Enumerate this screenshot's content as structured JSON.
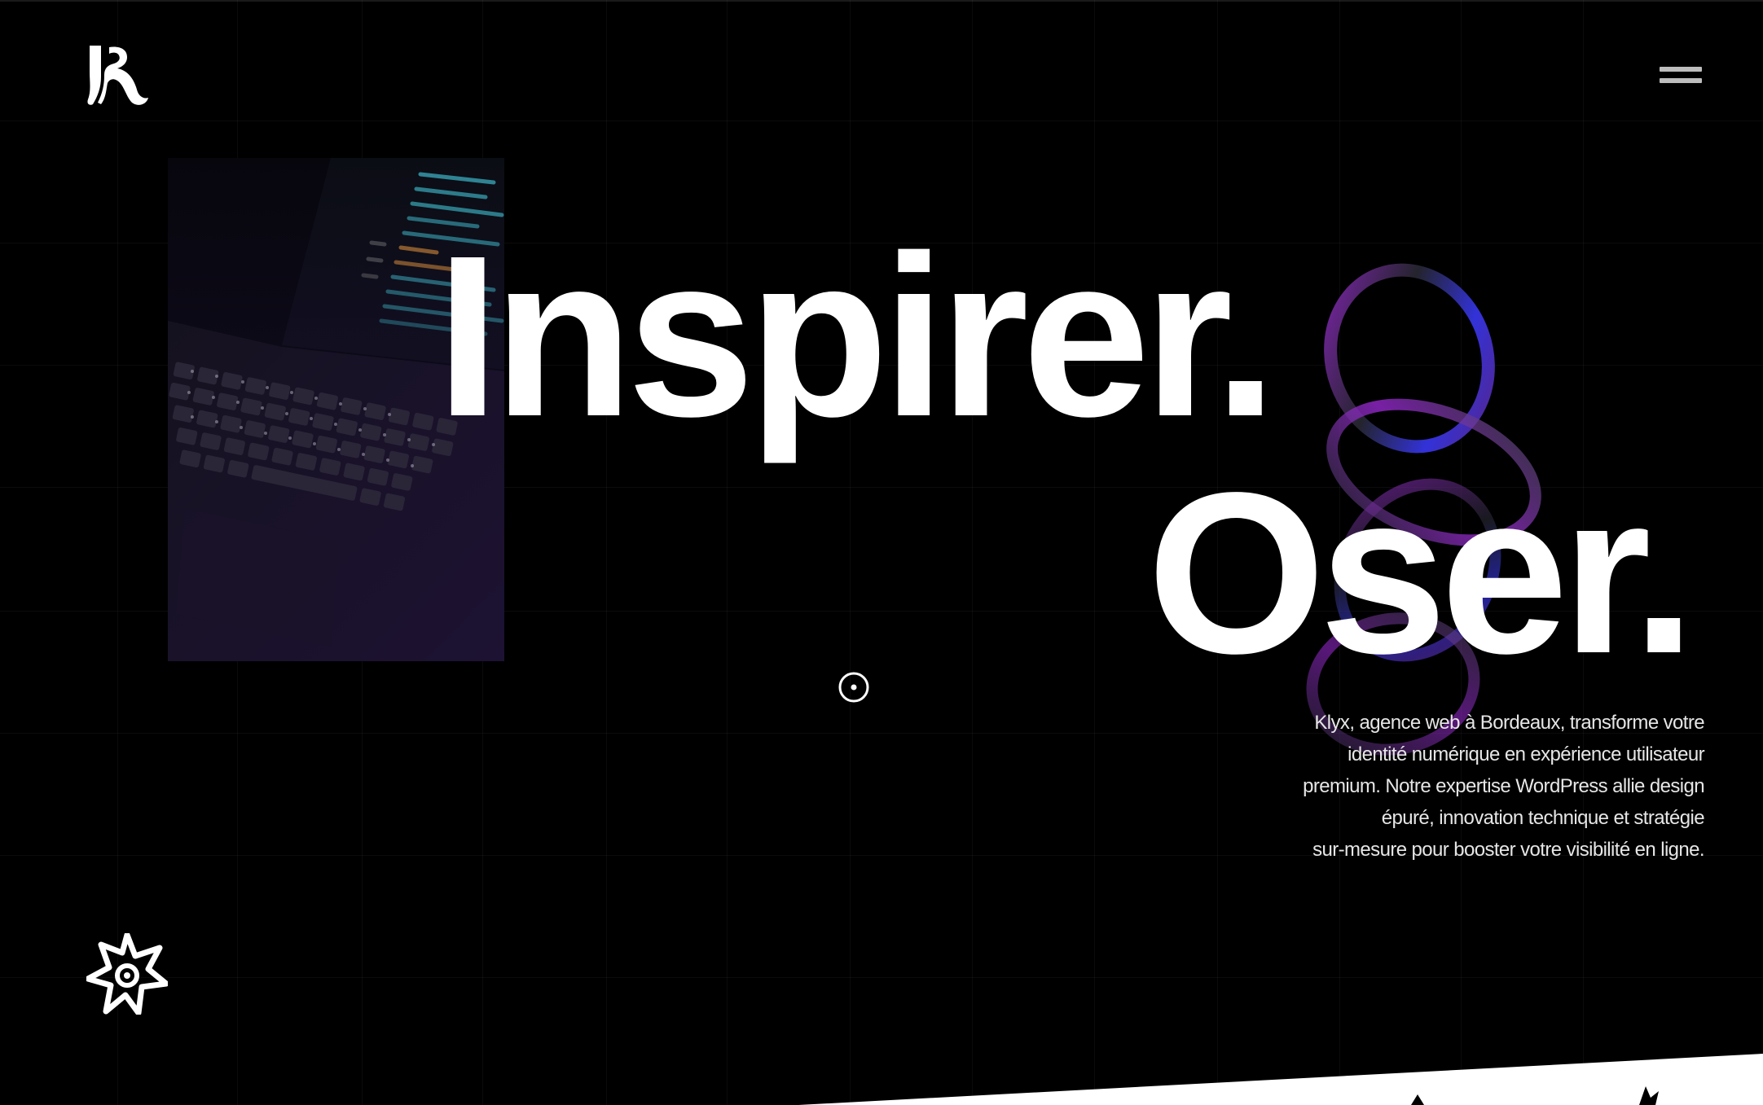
{
  "brand": {
    "logo_icon": "klyx-k-logo",
    "name": "Klyx"
  },
  "header": {
    "menu_icon": "hamburger-menu-icon"
  },
  "hero": {
    "line1": "Inspirer.",
    "line2": "Oser.",
    "description_lines": [
      "Klyx, agence web à Bordeaux, transforme votre",
      "identité numérique en expérience utilisateur",
      "premium. Notre expertise WordPress allie design",
      "épuré, innovation technique et stratégie",
      "sur-mesure pour booster votre visibilité en ligne."
    ],
    "scroll_icon": "target-circle-icon",
    "decoration_icon": "star-badge-icon"
  },
  "colors": {
    "background": "#000000",
    "text": "#ffffff",
    "accent_purple": "#8a2be2",
    "accent_blue": "#2a3bff"
  }
}
